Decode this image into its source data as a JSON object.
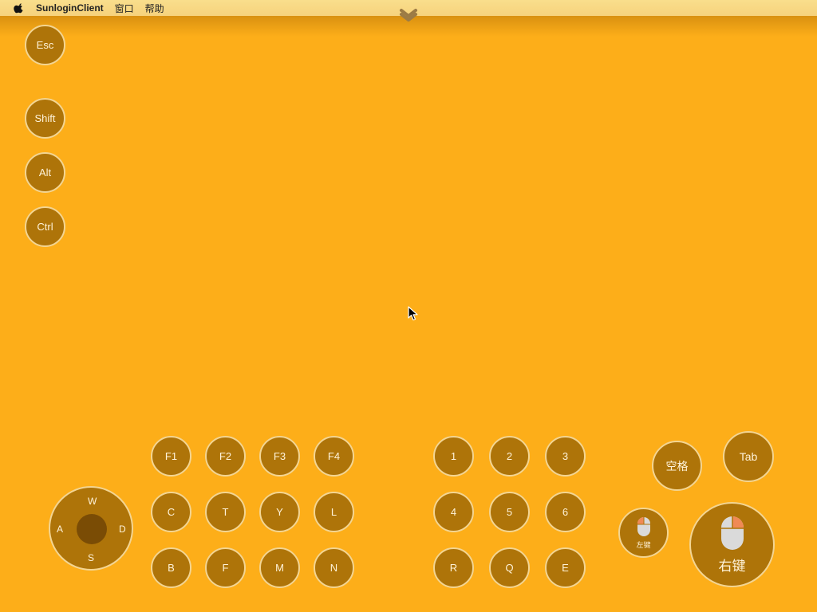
{
  "menubar": {
    "app_name": "SunloginClient",
    "menu_window": "窗口",
    "menu_help": "帮助"
  },
  "modifier_keys": {
    "esc": "Esc",
    "shift": "Shift",
    "alt": "Alt",
    "ctrl": "Ctrl"
  },
  "joystick": {
    "up": "W",
    "left": "A",
    "right": "D",
    "down": "S"
  },
  "letter_keys": {
    "f1": "F1",
    "f2": "F2",
    "f3": "F3",
    "f4": "F4",
    "c": "C",
    "t": "T",
    "y": "Y",
    "l": "L",
    "b": "B",
    "f": "F",
    "m": "M",
    "n": "N"
  },
  "number_keys": {
    "k1": "1",
    "k2": "2",
    "k3": "3",
    "k4": "4",
    "k5": "5",
    "k6": "6",
    "r": "R",
    "q": "Q",
    "e": "E"
  },
  "action_keys": {
    "space": "空格",
    "tab": "Tab",
    "left_click": "左键",
    "right_click": "右键"
  },
  "colors": {
    "background": "#FDAE19",
    "key_fill": "#AE7409",
    "key_border": "#F3D593",
    "joystick_knob": "#7A4C05",
    "mouse_button_highlight": "#F08A55"
  },
  "icons": {
    "apple": "apple-icon",
    "collapse": "chevron-double-down-icon",
    "mouse_left": "mouse-left-button-icon",
    "mouse_right": "mouse-right-button-icon",
    "cursor": "mouse-pointer-icon"
  }
}
